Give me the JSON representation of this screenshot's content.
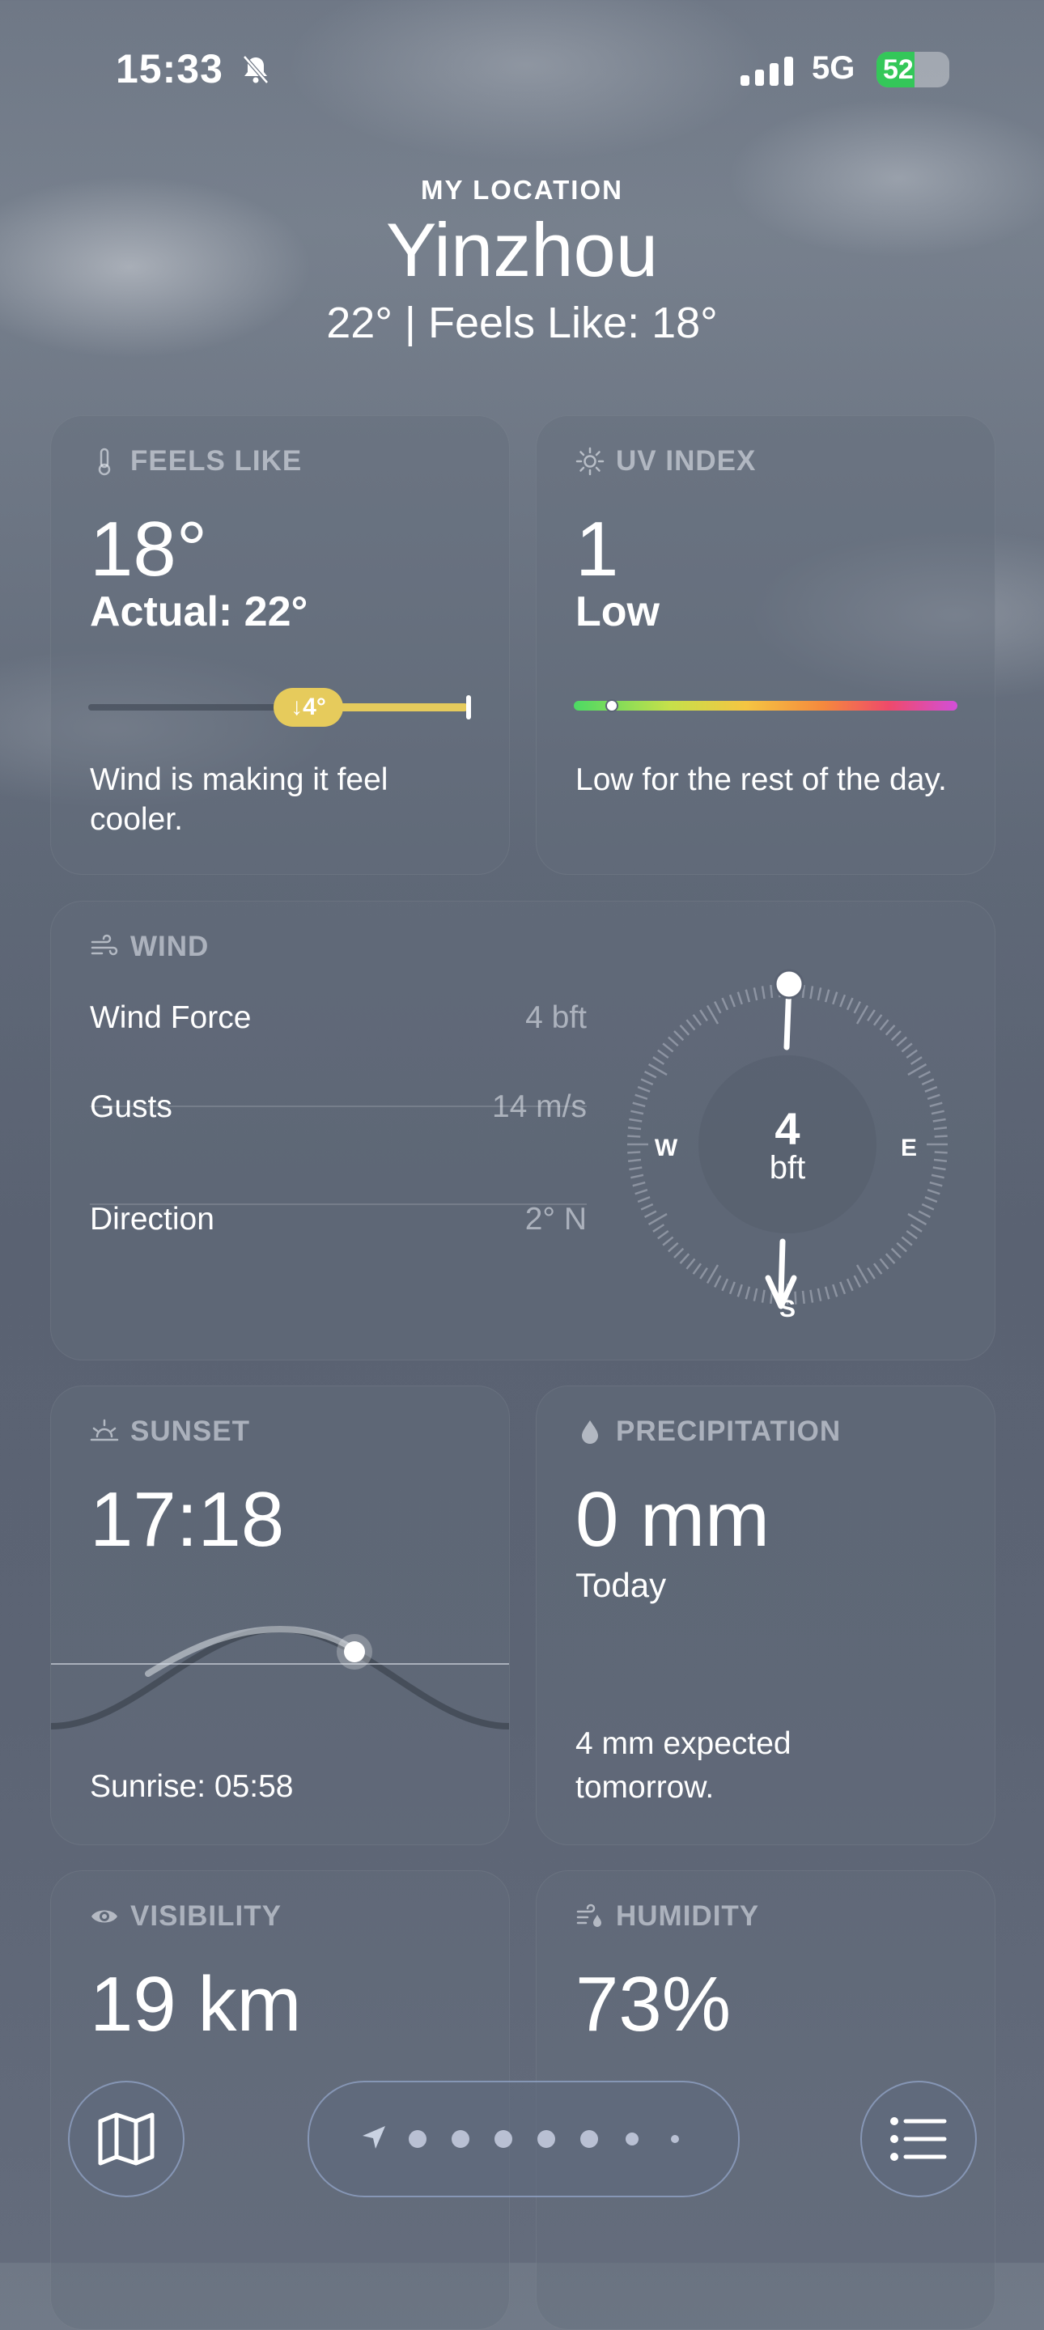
{
  "status_bar": {
    "time": "15:33",
    "network": "5G",
    "battery": "52",
    "battery_level": 0.52
  },
  "header": {
    "location_label": "MY LOCATION",
    "city": "Yinzhou",
    "summary": "22°  |  Feels Like: 18°"
  },
  "feels_like": {
    "title": "FEELS LIKE",
    "value": "18°",
    "actual": "Actual: 22°",
    "delta": "↓4°",
    "description": "Wind is making it feel cooler."
  },
  "uv_index": {
    "title": "UV INDEX",
    "value": "1",
    "level": "Low",
    "description": "Low for the rest of the day.",
    "scale_position": 0.1
  },
  "wind": {
    "title": "WIND",
    "rows": [
      {
        "label": "Wind Force",
        "value": "4 bft"
      },
      {
        "label": "Gusts",
        "value": "14 m/s"
      },
      {
        "label": "Direction",
        "value": "2° N"
      }
    ],
    "compass": {
      "center_value": "4",
      "center_unit": "bft",
      "west": "W",
      "east": "E",
      "south": "S"
    }
  },
  "sunset": {
    "title": "SUNSET",
    "value": "17:18",
    "sunrise": "Sunrise: 05:58"
  },
  "precipitation": {
    "title": "PRECIPITATION",
    "value": "0 mm",
    "period": "Today",
    "description": "4 mm expected tomorrow."
  },
  "visibility": {
    "title": "VISIBILITY",
    "value": "19 km"
  },
  "humidity": {
    "title": "HUMIDITY",
    "value": "73%"
  },
  "bottom_bar": {
    "map_icon": "map-icon",
    "list_icon": "list-icon",
    "location_icon": "location-arrow-icon",
    "page_count": 6
  }
}
